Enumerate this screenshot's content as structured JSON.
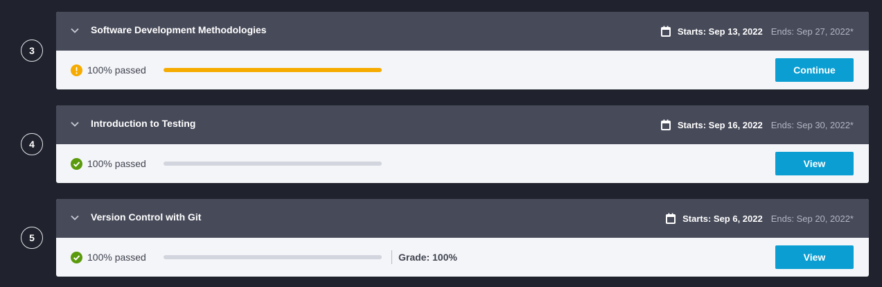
{
  "courses": [
    {
      "step": "3",
      "title": "Software Development Methodologies",
      "starts": "Starts: Sep 13, 2022",
      "ends": "Ends: Sep 27, 2022*",
      "status": "warning",
      "status_icon": "exclamation-icon",
      "passed_text": "100% passed",
      "progress_fraction": 1.0,
      "progress_color": "#f5ab00",
      "button_label": "Continue",
      "grade": ""
    },
    {
      "step": "4",
      "title": "Introduction to Testing",
      "starts": "Starts: Sep 16, 2022",
      "ends": "Ends: Sep 30, 2022*",
      "status": "success",
      "status_icon": "check-icon",
      "passed_text": "100% passed",
      "progress_fraction": 0,
      "progress_color": "#d3d5de",
      "button_label": "View",
      "grade": ""
    },
    {
      "step": "5",
      "title": "Version Control with Git",
      "starts": "Starts: Sep 6, 2022",
      "ends": "Ends: Sep 20, 2022*",
      "status": "success",
      "status_icon": "check-icon",
      "passed_text": "100% passed",
      "progress_fraction": 0,
      "progress_color": "#d3d5de",
      "button_label": "View",
      "grade": "Grade: 100%"
    }
  ],
  "colors": {
    "background": "#20222d",
    "header": "#474a59",
    "body": "#f4f5f9",
    "accent": "#0a9ed2",
    "warning": "#f5ab00",
    "success": "#5a9a0c"
  }
}
